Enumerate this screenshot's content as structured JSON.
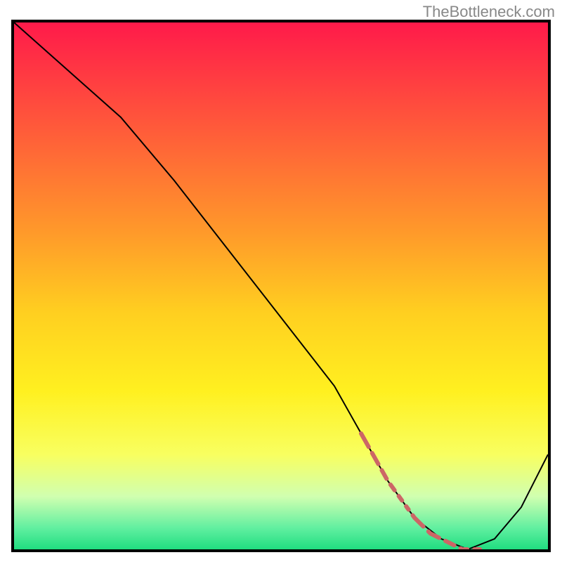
{
  "watermark_text": "TheBottleneck.com",
  "chart_data": {
    "type": "line",
    "title": "",
    "xlabel": "",
    "ylabel": "",
    "xlim": [
      0,
      100
    ],
    "ylim": [
      0,
      100
    ],
    "grid": false,
    "series": [
      {
        "name": "curve",
        "color": "#000000",
        "stroke_width": 2,
        "x": [
          0,
          10,
          20,
          30,
          40,
          50,
          60,
          65,
          70,
          75,
          80,
          85,
          90,
          95,
          100
        ],
        "y": [
          100,
          91,
          82,
          70,
          57,
          44,
          31,
          22,
          13,
          6,
          2,
          0,
          2,
          8,
          18
        ]
      },
      {
        "name": "highlight",
        "color": "#cc6666",
        "stroke_width": 6,
        "style": "dotted",
        "x": [
          65,
          70,
          75,
          78,
          80,
          82,
          84,
          86,
          88
        ],
        "y": [
          22,
          13,
          6,
          3,
          2,
          1,
          0,
          0,
          0
        ]
      }
    ],
    "gradient_stops": [
      {
        "offset": 0.0,
        "color": "#ff1a4a"
      },
      {
        "offset": 0.2,
        "color": "#ff5a3a"
      },
      {
        "offset": 0.4,
        "color": "#ff9a2a"
      },
      {
        "offset": 0.55,
        "color": "#ffcf20"
      },
      {
        "offset": 0.7,
        "color": "#fff020"
      },
      {
        "offset": 0.82,
        "color": "#f8ff60"
      },
      {
        "offset": 0.9,
        "color": "#d0ffb0"
      },
      {
        "offset": 0.96,
        "color": "#60efa0"
      },
      {
        "offset": 1.0,
        "color": "#20dd80"
      }
    ]
  }
}
